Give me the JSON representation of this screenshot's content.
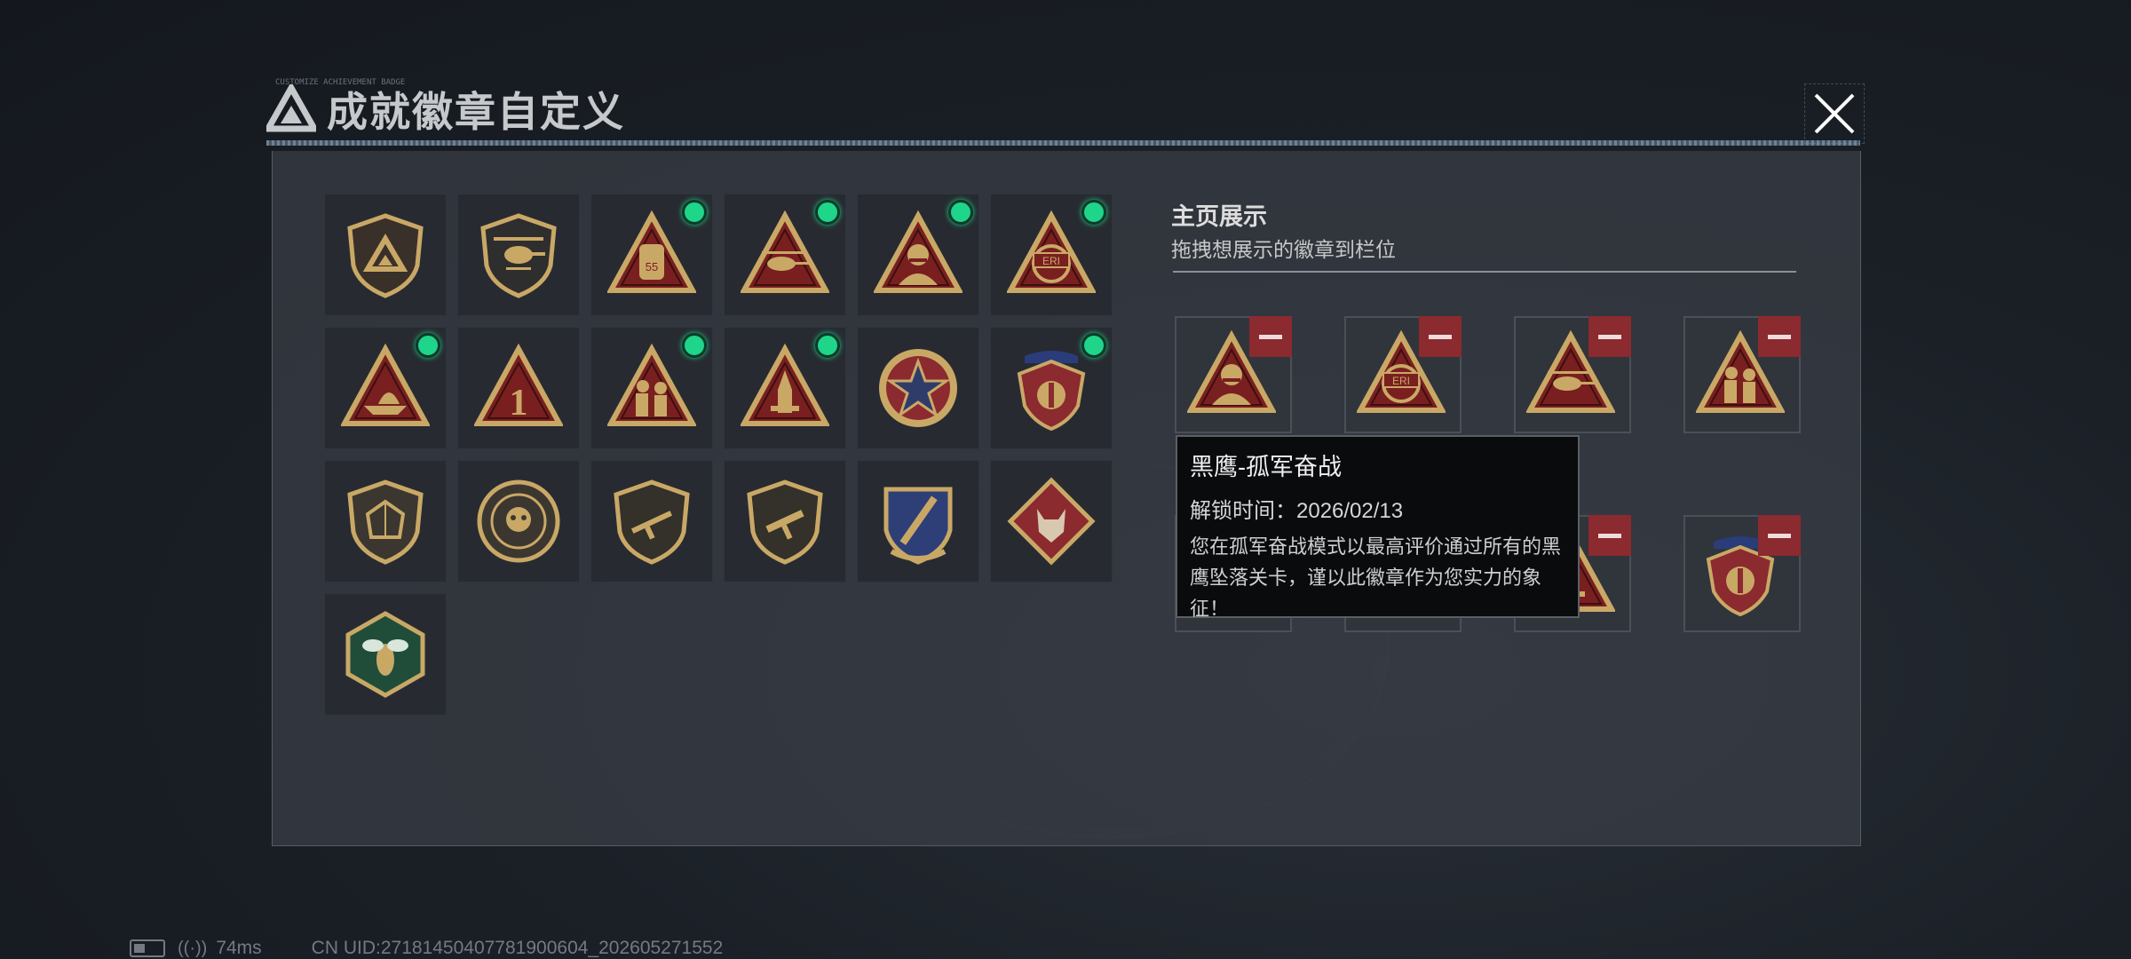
{
  "window": {
    "title": "成就徽章自定义",
    "subtitle_small": "CUSTOMIZE ACHIEVEMENT BADGE",
    "close_icon": "close-icon"
  },
  "colors": {
    "accent_green": "#1fd58a",
    "remove_red": "#8b2a2f",
    "badge_gold": "#c9a866",
    "badge_red": "#7a1f1f"
  },
  "badges": [
    {
      "icon": "delta-shield-badge",
      "new": false
    },
    {
      "icon": "helicopter-shield-badge",
      "new": false
    },
    {
      "icon": "backpack-55-badge",
      "new": true
    },
    {
      "icon": "helicopter-triangle-badge",
      "new": true
    },
    {
      "icon": "mustache-soldier-badge",
      "new": true
    },
    {
      "icon": "eri-globe-badge",
      "new": true
    },
    {
      "icon": "ship-triangle-badge",
      "new": true
    },
    {
      "icon": "number-one-badge",
      "new": false
    },
    {
      "icon": "soldiers-triangle-badge",
      "new": true
    },
    {
      "icon": "rocket-triangle-badge",
      "new": true
    },
    {
      "icon": "star-medal-badge",
      "new": false
    },
    {
      "icon": "crest-medal-badge",
      "new": true
    },
    {
      "icon": "d20-shield-badge",
      "new": false
    },
    {
      "icon": "skull-round-badge",
      "new": false
    },
    {
      "icon": "rifle-shield-badge",
      "new": false
    },
    {
      "icon": "smg-shield-badge",
      "new": false
    },
    {
      "icon": "sword-crest-badge",
      "new": false
    },
    {
      "icon": "wolf-diamond-badge",
      "new": false
    },
    {
      "icon": "wasp-hexagon-badge",
      "new": false
    }
  ],
  "showcase": {
    "title": "主页展示",
    "subtitle": "拖拽想展示的徽章到栏位",
    "slots": [
      {
        "icon": "mustache-soldier-badge"
      },
      {
        "icon": "eri-globe-badge"
      },
      {
        "icon": "helicopter-triangle-badge"
      },
      {
        "icon": "soldiers-triangle-badge"
      },
      {
        "icon": "ship-triangle-badge"
      },
      {
        "icon": "backpack-55-badge"
      },
      {
        "icon": "rocket-triangle-badge"
      },
      {
        "icon": "crest-medal-badge"
      }
    ]
  },
  "tooltip": {
    "title": "黑鹰-孤军奋战",
    "unlock": "解锁时间：2026/02/13",
    "description": "您在孤军奋战模式以最高评价通过所有的黑鹰坠落关卡，谨以此徽章作为您实力的象征！"
  },
  "status_bar": {
    "ping": "74ms",
    "uid": "CN UID:2718145040778190060­4_202605271552"
  }
}
